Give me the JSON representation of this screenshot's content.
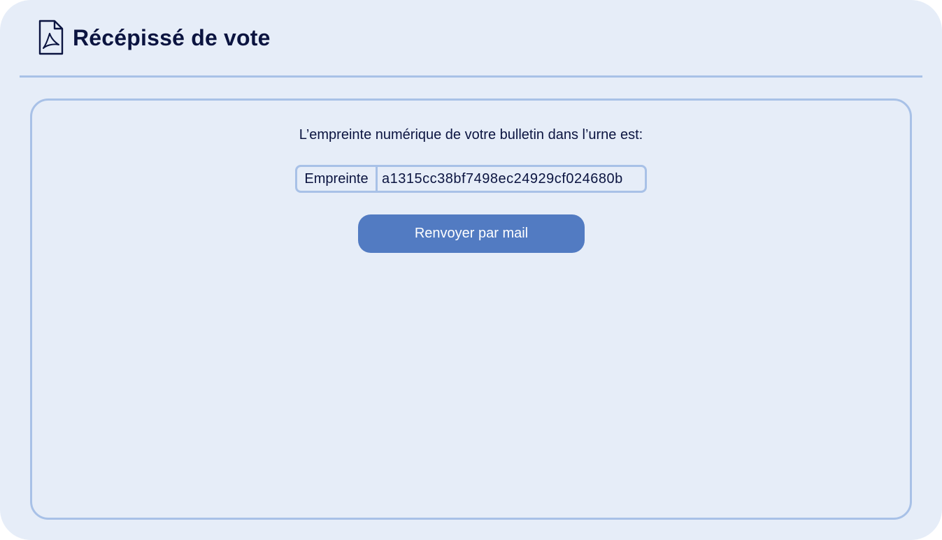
{
  "header": {
    "icon": "pdf-file-icon",
    "title": "Récépissé de vote"
  },
  "receipt": {
    "intro_text": "L’empreinte numérique de votre bulletin dans l’urne est:",
    "fingerprint_label": "Empreinte",
    "fingerprint_value": "a1315cc38bf7498ec24929cf024680b",
    "resend_button_label": "Renvoyer par mail"
  },
  "colors": {
    "background": "#e6edf8",
    "border": "#a8c1e7",
    "text": "#0b1440",
    "button": "#527bc2",
    "button_text": "#ffffff"
  }
}
